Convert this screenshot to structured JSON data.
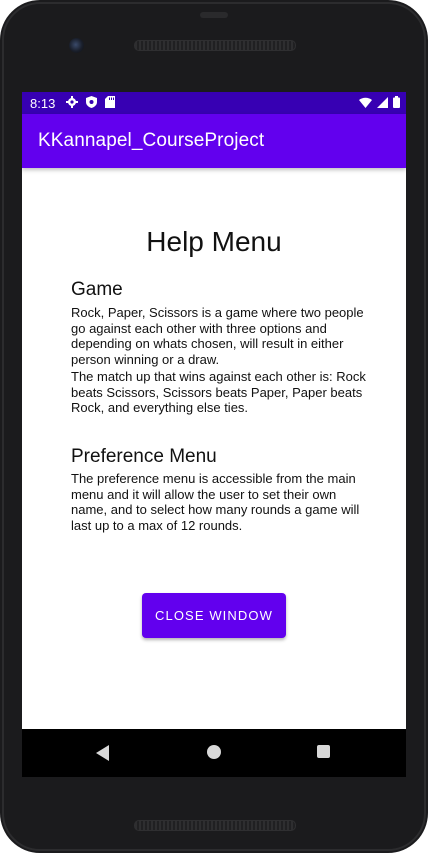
{
  "status_bar": {
    "time": "8:13",
    "left_icons": [
      "gear-icon",
      "shield-icon",
      "sd-card-icon"
    ],
    "right_icons": [
      "wifi-icon",
      "signal-icon",
      "battery-icon"
    ],
    "background_color": "#3700b3"
  },
  "app_bar": {
    "title": "KKannapel_CourseProject",
    "background_color": "#6200ee"
  },
  "help": {
    "title": "Help Menu",
    "game": {
      "heading": "Game",
      "paragraph1": "Rock, Paper, Scissors is a game where two people go against each other with three options and depending on whats chosen, will result in either person winning or a draw.",
      "paragraph2": "The match up that wins against each other is: Rock beats Scissors, Scissors beats Paper, Paper beats Rock, and everything else ties."
    },
    "preference": {
      "heading": "Preference Menu",
      "paragraph": "The preference menu is accessible from the main menu and it will allow the user to set their own name, and to select how many rounds a game will last up to a max of 12 rounds."
    },
    "close_button_label": "CLOSE WINDOW"
  },
  "nav_bar": {
    "buttons": [
      "back-icon",
      "home-icon",
      "recents-icon"
    ]
  }
}
